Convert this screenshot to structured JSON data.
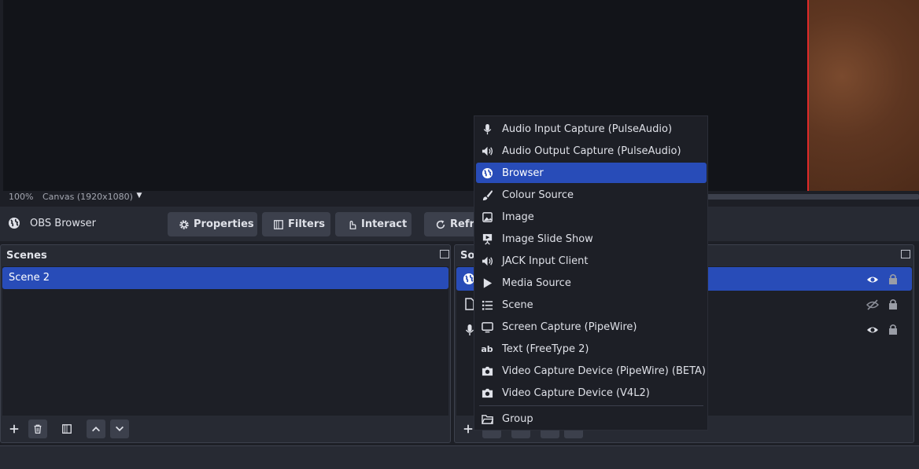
{
  "preview": {
    "zoom": "100%",
    "canvas_label": "Canvas (1920x1080)"
  },
  "context_bar": {
    "source_name": "OBS Browser",
    "properties_label": "Properties",
    "filters_label": "Filters",
    "interact_label": "Interact",
    "refresh_label": "Refre"
  },
  "scenes": {
    "title": "Scenes",
    "items": [
      "Scene 2"
    ]
  },
  "sources": {
    "title": "Sou"
  },
  "add_source_menu": {
    "items": [
      {
        "label": "Audio Input Capture (PulseAudio)",
        "icon": "microphone-icon"
      },
      {
        "label": "Audio Output Capture (PulseAudio)",
        "icon": "speaker-icon"
      },
      {
        "label": "Browser",
        "icon": "globe-icon"
      },
      {
        "label": "Colour Source",
        "icon": "brush-icon"
      },
      {
        "label": "Image",
        "icon": "image-icon"
      },
      {
        "label": "Image Slide Show",
        "icon": "slideshow-icon"
      },
      {
        "label": "JACK Input Client",
        "icon": "speaker-icon"
      },
      {
        "label": "Media Source",
        "icon": "play-icon"
      },
      {
        "label": "Scene",
        "icon": "list-icon"
      },
      {
        "label": "Screen Capture (PipeWire)",
        "icon": "monitor-icon"
      },
      {
        "label": "Text (FreeType 2)",
        "icon": "text-ab-icon"
      },
      {
        "label": "Video Capture Device (PipeWire) (BETA)",
        "icon": "camera-icon"
      },
      {
        "label": "Video Capture Device (V4L2)",
        "icon": "camera-icon"
      },
      {
        "label": "Group",
        "icon": "folder-icon"
      }
    ],
    "active_item": "Browser"
  },
  "colors": {
    "accent": "#284cb8",
    "background": "#1d1f26",
    "panel": "#272a33",
    "preview_border": "#e02a2a"
  }
}
